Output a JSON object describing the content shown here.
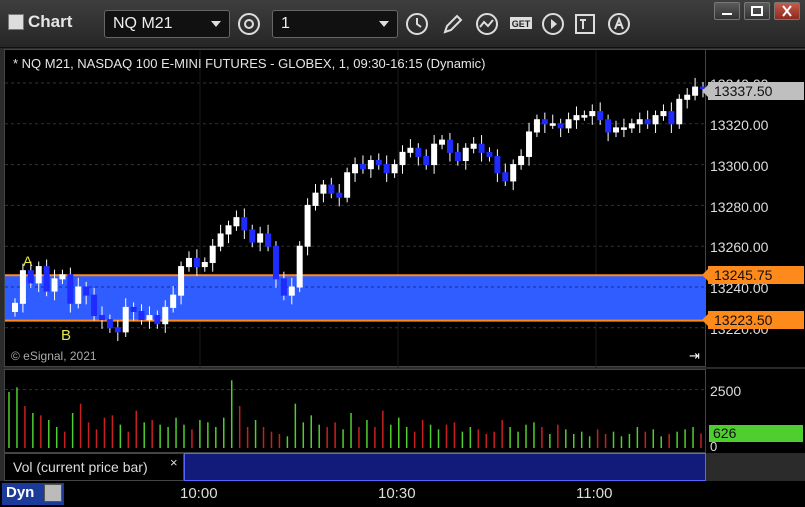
{
  "window": {
    "title": "Chart",
    "symbol": "NQ M21",
    "interval": "1"
  },
  "header": {
    "description": "* NQ M21, NASDAQ 100 E-MINI FUTURES - GLOBEX, 1, 09:30-16:15 (Dynamic)"
  },
  "watermark": "© eSignal, 2021",
  "icons": [
    "settings-icon",
    "clock-icon",
    "pencil-icon",
    "study-icon",
    "get-icon",
    "play-icon",
    "text-tool-icon",
    "alert-icon",
    "minimize-icon",
    "restore-icon",
    "close-icon",
    "scroll-to-end-icon",
    "lock-icon"
  ],
  "price_axis": {
    "labels": [
      "13340.00",
      "13320.00",
      "13300.00",
      "13280.00",
      "13260.00",
      "13240.00",
      "13220.00"
    ],
    "last_price": "13337.50",
    "line_high": "13245.75",
    "line_low": "13223.50"
  },
  "volume": {
    "legend": "Vol (current price bar)",
    "close_symbol": "×",
    "axis_top": "2500",
    "axis_zero": "0",
    "last_volume": "626"
  },
  "time_axis": {
    "labels": [
      "10:00",
      "10:30",
      "11:00"
    ],
    "mode": "Dyn"
  },
  "annotations": {
    "a": "A",
    "b": "B"
  },
  "colors": {
    "up": "#ffffff",
    "down": "#1f2bff",
    "band": "#2f5dff",
    "line": "#ff8a1c",
    "vol_up": "#4fcf2f",
    "vol_down": "#c72020"
  },
  "chart_data": {
    "type": "candlestick",
    "title": "NQ M21, NASDAQ 100 E-MINI FUTURES - GLOBEX",
    "ylim": [
      13210,
      13345
    ],
    "horizontal_lines": [
      13245.75,
      13223.5
    ],
    "series": [
      {
        "name": "NQ M21",
        "closes": [
          13232,
          13248,
          13242,
          13250,
          13238,
          13244,
          13246,
          13232,
          13240,
          13236,
          13226,
          13224,
          13220,
          13218,
          13230,
          13228,
          13224,
          13226,
          13222,
          13230,
          13236,
          13250,
          13254,
          13250,
          13252,
          13260,
          13266,
          13270,
          13274,
          13268,
          13262,
          13266,
          13260,
          13244,
          13236,
          13240,
          13260,
          13280,
          13286,
          13290,
          13286,
          13284,
          13296,
          13300,
          13298,
          13302,
          13300,
          13296,
          13300,
          13306,
          13308,
          13304,
          13300,
          13310,
          13312,
          13306,
          13302,
          13308,
          13310,
          13306,
          13304,
          13296,
          13292,
          13300,
          13304,
          13316,
          13322,
          13320,
          13320,
          13318,
          13322,
          13324,
          13324,
          13326,
          13322,
          13316,
          13318,
          13318,
          13320,
          13322,
          13320,
          13324,
          13326,
          13320,
          13332,
          13334,
          13338,
          13337.5
        ]
      }
    ],
    "volume_values": [
      2400,
      2600,
      1800,
      1500,
      1400,
      1200,
      900,
      700,
      1500,
      1900,
      1100,
      800,
      1300,
      1400,
      1000,
      700,
      1600,
      1100,
      1200,
      1000,
      900,
      1300,
      1000,
      800,
      1200,
      1100,
      900,
      1300,
      2900,
      1800,
      900,
      1200,
      900,
      700,
      600,
      500,
      1900,
      1100,
      1400,
      1000,
      900,
      1100,
      800,
      1500,
      900,
      1200,
      900,
      1600,
      1000,
      1300,
      900,
      700,
      1200,
      1000,
      800,
      1000,
      1100,
      700,
      900,
      800,
      600,
      700,
      1200,
      900,
      700,
      1000,
      1100,
      900,
      600,
      1000,
      800,
      600,
      700,
      500,
      800,
      600,
      700,
      500,
      600,
      900,
      700,
      800,
      500,
      600,
      700,
      800,
      900,
      626
    ],
    "volume_ylim": [
      0,
      3000
    ]
  }
}
